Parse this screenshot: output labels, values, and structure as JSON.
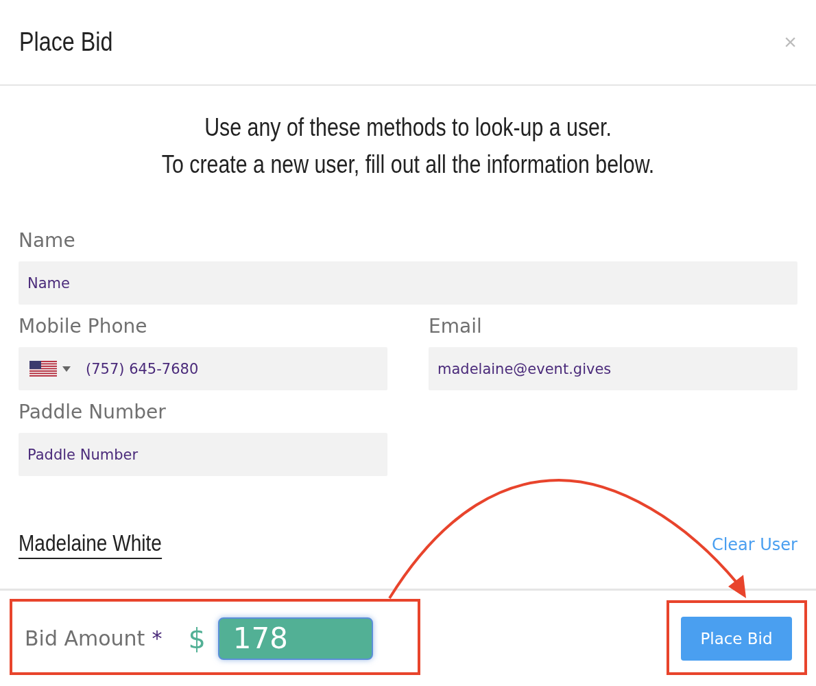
{
  "modal": {
    "title": "Place Bid",
    "close": "×"
  },
  "intro": [
    "Use any of these methods to look-up a user.",
    "To create a new user, fill out all the information below."
  ],
  "fields": [
    {
      "kind": "text",
      "label": "Name",
      "placeholder": "Name"
    },
    {
      "kind": "phone",
      "label": "Mobile Phone",
      "value": "(757) 645-7680"
    },
    {
      "kind": "text",
      "label": "Email",
      "value": "madelaine@event.gives"
    },
    {
      "kind": "text",
      "label": "Paddle Number",
      "placeholder": "Paddle Number"
    }
  ],
  "user": {
    "name": "Madelaine White",
    "clear_link": "Clear User"
  },
  "footer": {
    "bid_label": "Bid Amount",
    "required_mark": "*",
    "currency": "$",
    "bid_value": "178",
    "button": "Place Bid"
  },
  "annotations": [
    {
      "kind": "frame"
    },
    {
      "kind": "frame"
    },
    {
      "kind": "arrow"
    }
  ]
}
